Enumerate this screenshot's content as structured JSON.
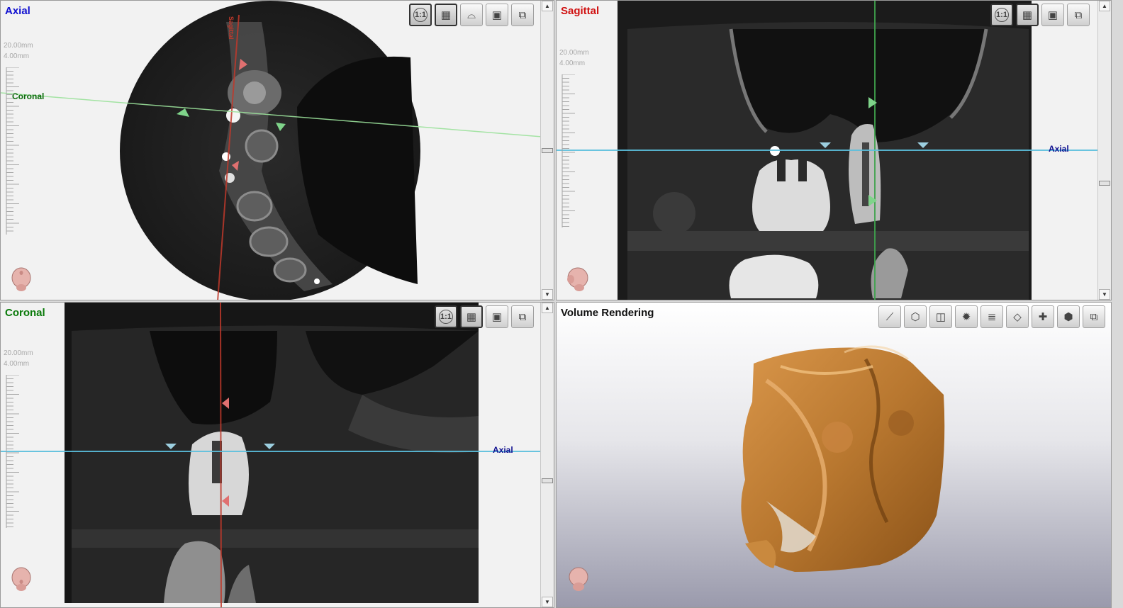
{
  "panels": {
    "axial": {
      "title": "Axial",
      "title_color": "#1010d0",
      "scale_line1": "20.00mm",
      "scale_line2": "4.00mm",
      "line_label": "Coronal",
      "line_label_color": "#0a6a0a",
      "toolbar": [
        {
          "label": "1:1",
          "icon": "one-to-one-zoom-icon",
          "active": true
        },
        {
          "label": "",
          "icon": "slice-layout-icon",
          "active": true
        },
        {
          "label": "",
          "icon": "panoramic-icon",
          "active": false
        },
        {
          "label": "",
          "icon": "volume-box-icon",
          "active": false
        },
        {
          "label": "",
          "icon": "maximize-panel-icon",
          "active": false
        }
      ]
    },
    "sagittal": {
      "title": "Sagittal",
      "title_color": "#d01010",
      "scale_line1": "20.00mm",
      "scale_line2": "4.00mm",
      "line_label": "Axial",
      "line_label_color": "#101090",
      "toolbar": [
        {
          "label": "1:1",
          "icon": "one-to-one-zoom-icon",
          "active": true
        },
        {
          "label": "",
          "icon": "slice-layout-icon",
          "active": true
        },
        {
          "label": "",
          "icon": "volume-box-icon",
          "active": false
        },
        {
          "label": "",
          "icon": "maximize-panel-icon",
          "active": false
        }
      ]
    },
    "coronal": {
      "title": "Coronal",
      "title_color": "#0a7a0a",
      "scale_line1": "20.00mm",
      "scale_line2": "4.00mm",
      "line_label": "Axial",
      "line_label_color": "#101090",
      "toolbar": [
        {
          "label": "1:1",
          "icon": "one-to-one-zoom-icon",
          "active": true
        },
        {
          "label": "",
          "icon": "slice-layout-icon",
          "active": true
        },
        {
          "label": "",
          "icon": "volume-box-icon",
          "active": false
        },
        {
          "label": "",
          "icon": "maximize-panel-icon",
          "active": false
        }
      ]
    },
    "volume": {
      "title": "Volume Rendering",
      "title_color": "#111111",
      "toolbar": [
        {
          "label": "",
          "icon": "clip-plane-icon",
          "active": false
        },
        {
          "label": "",
          "icon": "orientation-cube-icon",
          "active": false
        },
        {
          "label": "",
          "icon": "crop-box-icon",
          "active": false
        },
        {
          "label": "",
          "icon": "light-icon",
          "active": false
        },
        {
          "label": "",
          "icon": "layers-icon",
          "active": false
        },
        {
          "label": "",
          "icon": "annotation-cube-icon",
          "active": false
        },
        {
          "label": "",
          "icon": "crosshair-icon",
          "active": false
        },
        {
          "label": "",
          "icon": "render-preset-icon",
          "active": false
        },
        {
          "label": "",
          "icon": "maximize-panel-icon",
          "active": false
        }
      ]
    }
  },
  "colors": {
    "sagittal_line": "#c0392b",
    "coronal_line": "#3fa34d",
    "axial_line": "#5bc0de",
    "bone_render": "#b8772f",
    "scan_bg": "#1b1b1b"
  }
}
